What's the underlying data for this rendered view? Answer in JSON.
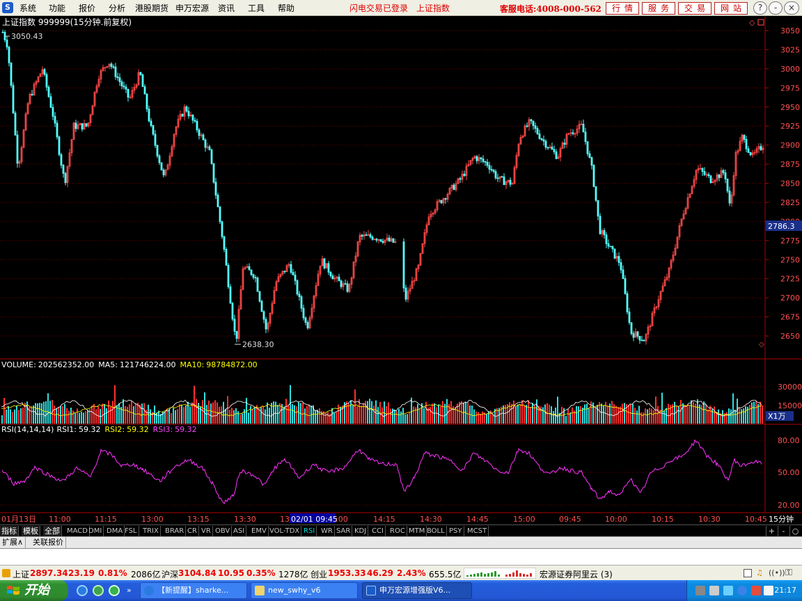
{
  "menubar": {
    "logo": "S",
    "items": [
      "系统",
      "功能",
      "报价",
      "分析",
      "港股期货",
      "申万宏源",
      "资讯",
      "工具",
      "帮助"
    ],
    "notice1": "闪电交易已登录",
    "notice2": "上证指数",
    "hotline": "客服电话:4008-000-562",
    "buttons": [
      "行情",
      "服务",
      "交易",
      "网站"
    ],
    "window_controls": [
      "?",
      "-",
      "□",
      "×"
    ]
  },
  "main_chart": {
    "title": "上证指数 999999(15分钟.前复权)",
    "high_label": "3050.43",
    "low_label": "2638.30",
    "price_ticks": [
      "3050",
      "3025",
      "3000",
      "2975",
      "2950",
      "2925",
      "2900",
      "2875",
      "2850",
      "2825",
      "2800",
      "2775",
      "2750",
      "2725",
      "2700",
      "2675",
      "2650"
    ],
    "current_price": "2786.3",
    "colors": {
      "up": "#ff4a4a",
      "down": "#54ffff",
      "grid": "#7a0000",
      "axis": "#b00000"
    }
  },
  "volume_panel": {
    "label": "VOLUME:",
    "value": "202562352.00",
    "ma5_label": "MA5:",
    "ma5_value": "121746224.00",
    "ma10_label": "MA10:",
    "ma10_value": "98784872.00",
    "ticks": [
      "30000",
      "15000"
    ],
    "unit": "X1万"
  },
  "rsi_panel": {
    "label": "RSI(14,14,14)",
    "rsi1_label": "RSI1:",
    "rsi1": "59.32",
    "rsi2_label": "RSI2:",
    "rsi2": "59.32",
    "rsi3_label": "RSI3:",
    "rsi3": "59.32",
    "ticks": [
      "80.00",
      "50.00",
      "20.00"
    ]
  },
  "time_axis": {
    "labels": [
      "01月13日",
      "11:00",
      "11:15",
      "13:00",
      "13:15",
      "13:30",
      "13",
      "14:15",
      "14:30",
      "14:45",
      "15:00",
      "09:45",
      "10:00",
      "10:15",
      "10:30",
      "10:45"
    ],
    "cursor": "02/01 09:45",
    "cursor_suffix": ":00",
    "period": "15分钟"
  },
  "indicator_tabs": {
    "lead": [
      "指标",
      "模板",
      "全部"
    ],
    "items": [
      "MACD",
      "DMI",
      "DMA",
      "FSL",
      "TRIX",
      "BRAR",
      "CR",
      "VR",
      "OBV",
      "ASI",
      "EMV",
      "VOL-TDX",
      "RSI",
      "WR",
      "SAR",
      "KDJ",
      "CCI",
      "ROC",
      "MTM",
      "BOLL",
      "PSY",
      "MCST"
    ],
    "active": "RSI",
    "right_buttons": [
      "+",
      "-",
      "○"
    ]
  },
  "ext_tabs": [
    "扩展∧",
    "关联报价"
  ],
  "status": {
    "sh_label": "上证",
    "sh_value": "2897.34",
    "sh_change": "23.19",
    "sh_pct": "0.81%",
    "sh_amount": "2086亿",
    "hs_label": "沪深",
    "hs_value": "3104.84",
    "hs_change": "10.95",
    "hs_pct": "0.35%",
    "hs_amount": "1278亿",
    "cy_label": "创业",
    "cy_value": "1953.33",
    "cy_change": "46.29",
    "cy_pct": "2.43%",
    "cy_amount": "655.5亿",
    "broker": "宏源证券阿里云 (3)"
  },
  "taskbar": {
    "start": "开始",
    "tasks": [
      "【新提醒】sharke...",
      "new_swhy_v6",
      "申万宏源增强版V6..."
    ],
    "clock": "21:17"
  }
}
